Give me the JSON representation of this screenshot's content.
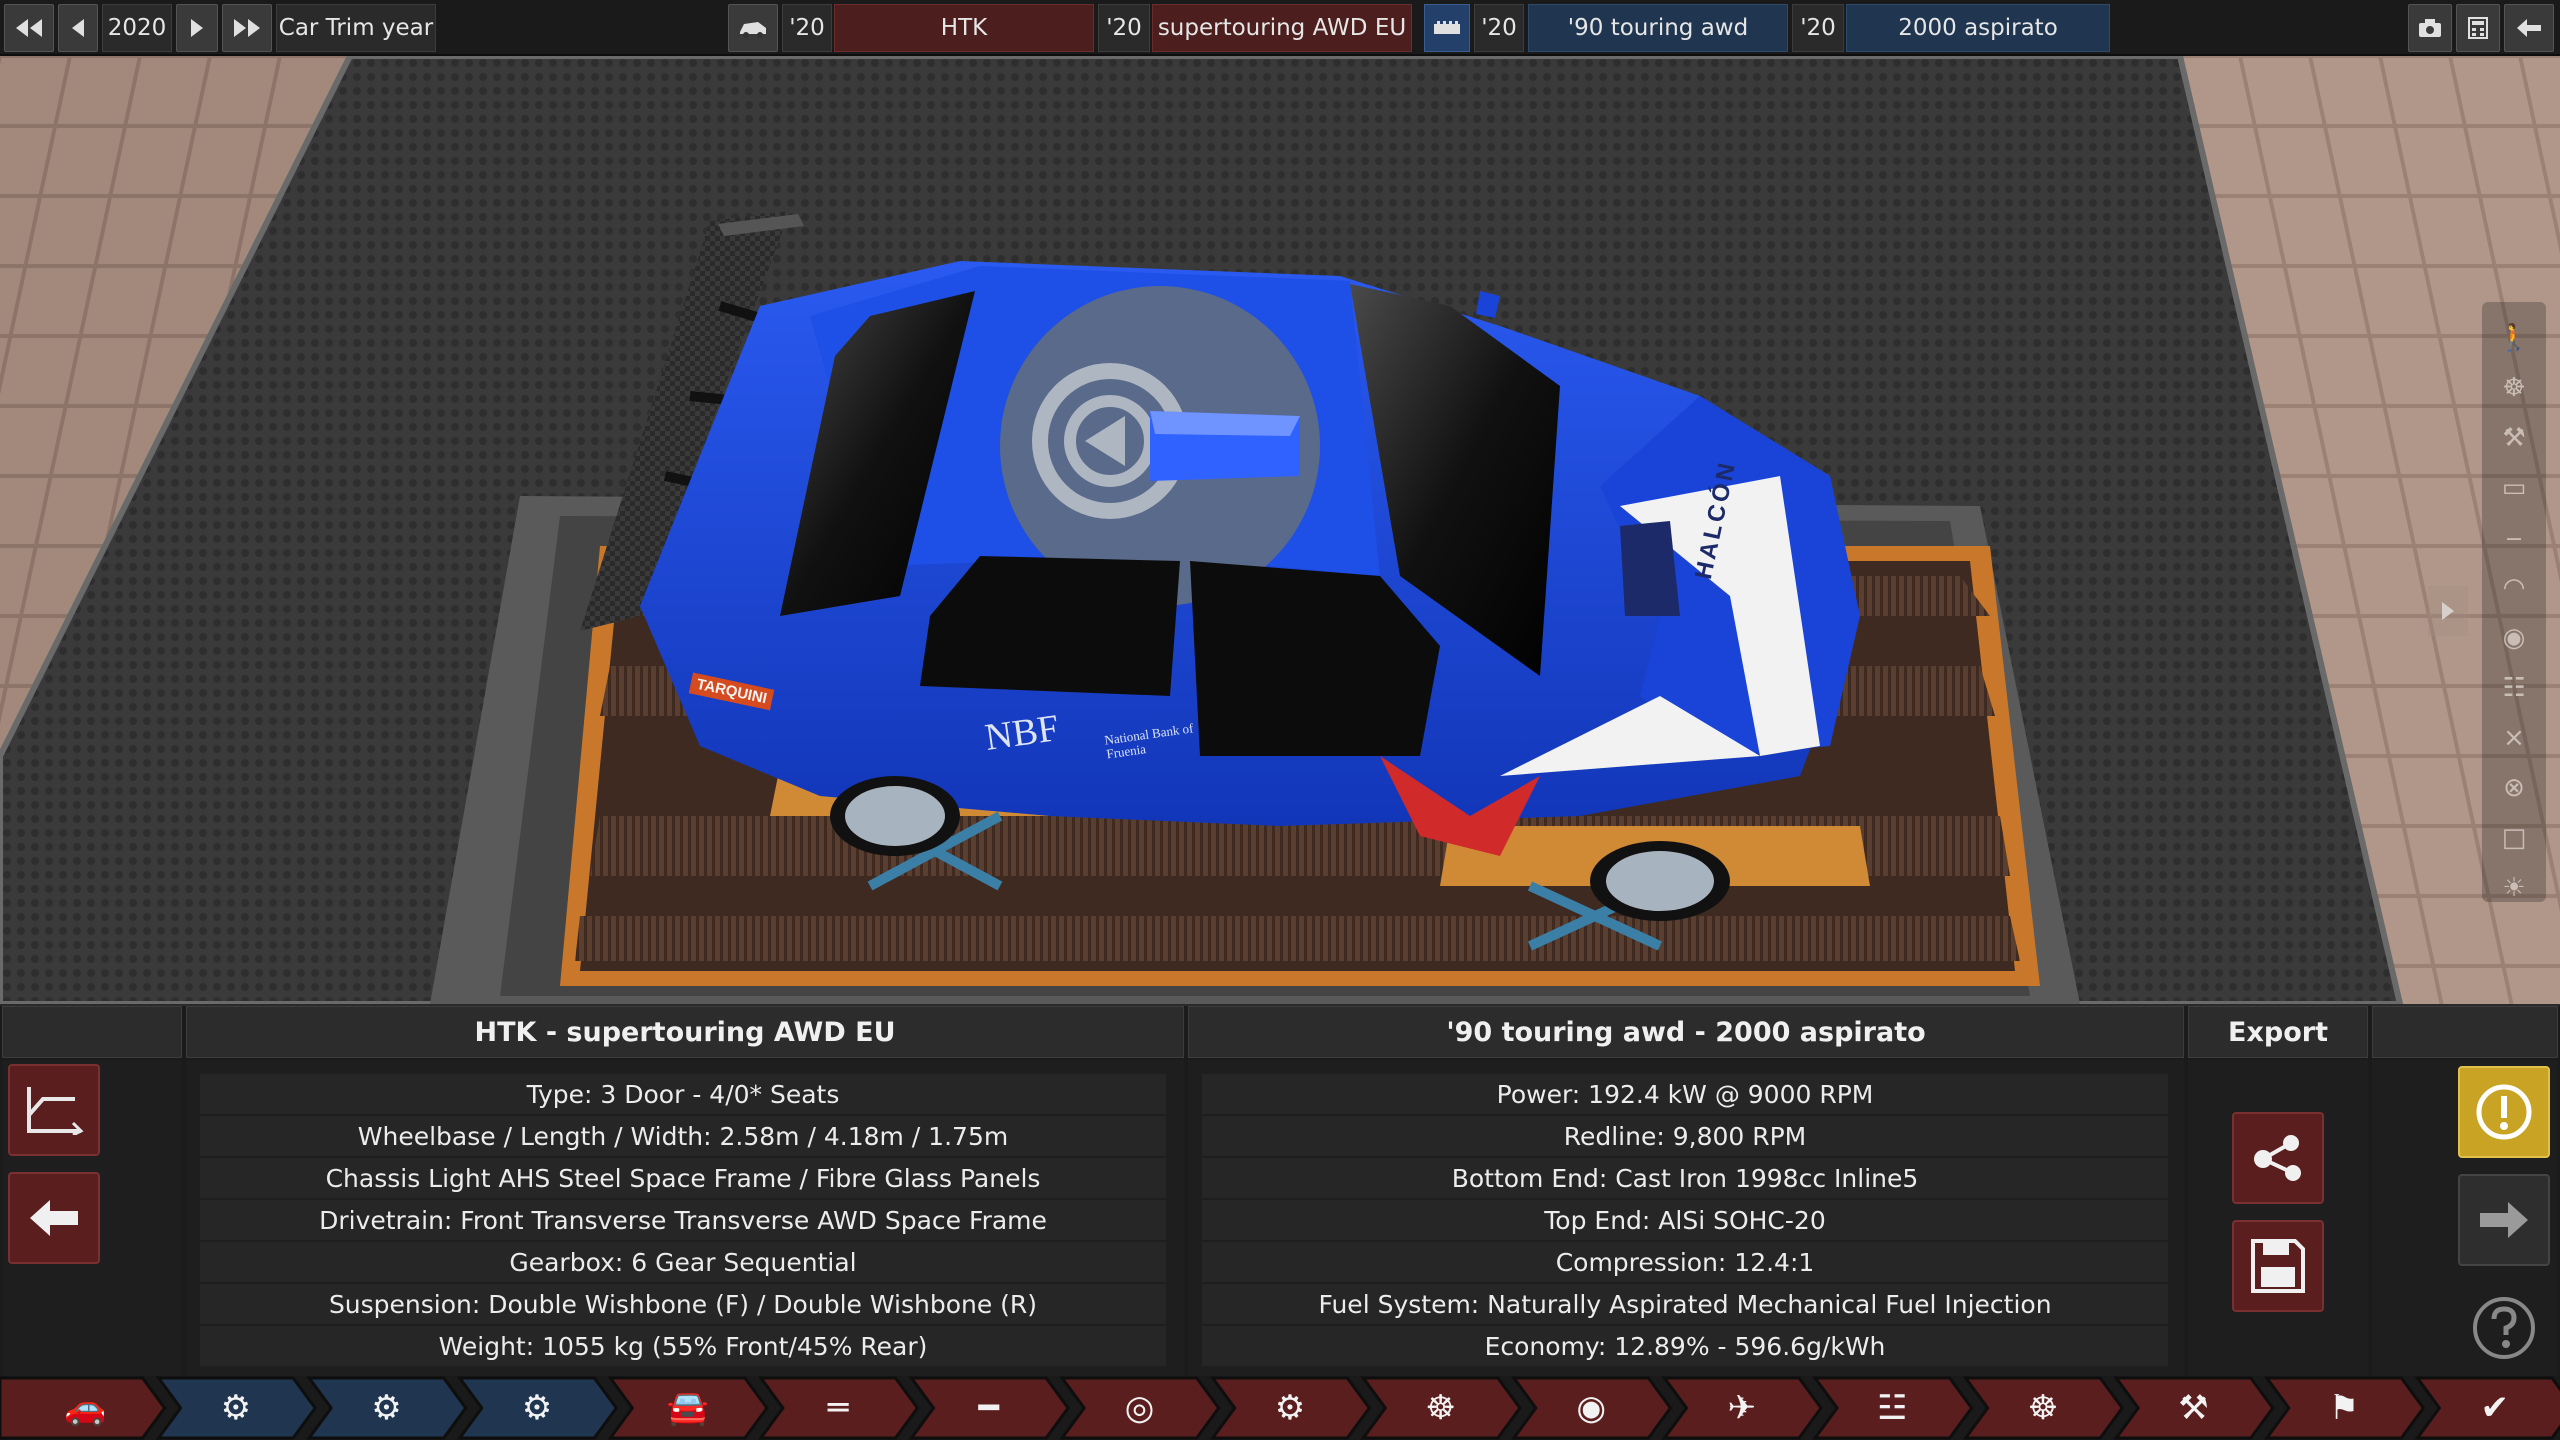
{
  "topbar": {
    "year": "2020",
    "year_label": "Car Trim year",
    "model_year": "'20",
    "model_name": "HTK",
    "trim_year": "'20",
    "trim_name": "supertouring AWD EU",
    "engine_family_year": "'20",
    "engine_family_name": "'90 touring awd",
    "engine_variant_year": "'20",
    "engine_variant_name": "2000 aspirato"
  },
  "car_info": {
    "header": "HTK - supertouring AWD EU",
    "rows": [
      "Type: 3 Door - 4/0* Seats",
      "Wheelbase / Length / Width: 2.58m / 4.18m / 1.75m",
      "Chassis Light AHS Steel Space Frame / Fibre Glass Panels",
      "Drivetrain: Front Transverse Transverse AWD Space Frame",
      "Gearbox: 6 Gear Sequential",
      "Suspension: Double Wishbone (F) / Double Wishbone (R)",
      "Weight: 1055 kg (55% Front/45% Rear)"
    ]
  },
  "engine_info": {
    "header": "'90 touring awd - 2000 aspirato",
    "rows": [
      "Power: 192.4 kW @ 9000 RPM",
      "Redline:  9,800 RPM",
      "Bottom End: Cast Iron 1998cc Inline5",
      "Top End: AlSi SOHC-20",
      "Compression: 12.4:1",
      "Fuel System: Naturally Aspirated Mechanical Fuel Injection",
      "Economy: 12.89% - 596.6g/kWh"
    ]
  },
  "export": {
    "header": "Export"
  },
  "car_decals": {
    "hood_brand": "HALCÓN",
    "side_sponsor": "NBF",
    "side_sponsor_sub": "National Bank of Fruenia",
    "rear_sponsor": "TARQUINI"
  },
  "colors": {
    "car_body": "#1a44d8",
    "nav_red": "#5a1e1e",
    "nav_blue": "#1f3550",
    "warning_yellow": "#c9a424"
  },
  "icons": {
    "right_rail": [
      "walk-icon",
      "wheel-icon",
      "spray-icon",
      "battery-icon",
      "seat-icon",
      "cap-icon",
      "car-front-icon",
      "grille-icon",
      "suspension-icon",
      "tire-icon",
      "frame-icon",
      "lightbulb-icon"
    ],
    "bottom_nav": [
      "car-body-icon",
      "engine-folder-icon",
      "engine-block-icon",
      "engine-tree-icon",
      "car-tree-icon",
      "chassis-icon",
      "drivetrain-icon",
      "suspension-icon",
      "gearbox-icon",
      "wheels-icon",
      "brakes-icon",
      "aero-icon",
      "interior-icon",
      "steering-icon",
      "tune-icon",
      "test-track-icon",
      "confirm-icon"
    ]
  }
}
